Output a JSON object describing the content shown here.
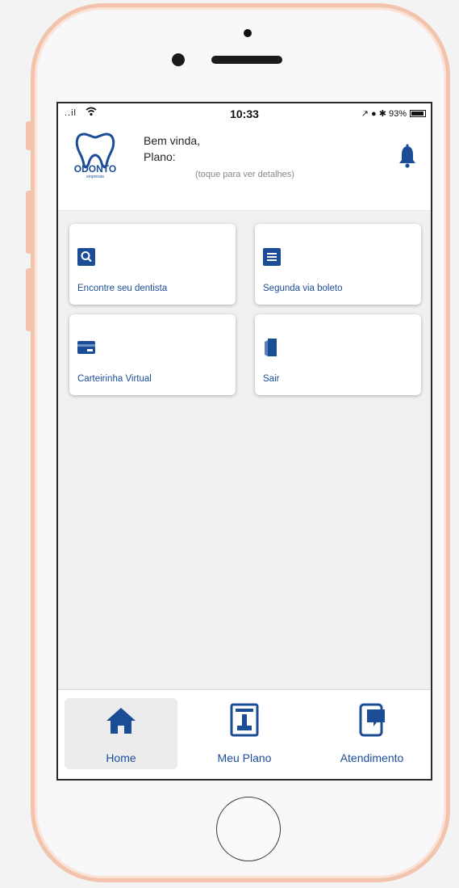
{
  "status_bar": {
    "signal": "..il",
    "time": "10:33",
    "right_indicators": "↗ ● ✱ 93%"
  },
  "header": {
    "logo_text": "ODONTO",
    "logo_sub": "empresas",
    "greeting_line1": "Bem vinda,",
    "greeting_line2": "Plano:",
    "hint": "(toque para ver detalhes)"
  },
  "menu": [
    {
      "label": "Encontre seu dentista",
      "icon": "search-icon"
    },
    {
      "label": "Segunda via boleto",
      "icon": "document-icon"
    },
    {
      "label": "Carteirinha Virtual",
      "icon": "card-icon"
    },
    {
      "label": "Sair",
      "icon": "door-exit-icon"
    }
  ],
  "tabs": [
    {
      "label": "Home",
      "icon": "home-icon",
      "active": true
    },
    {
      "label": "Meu Plano",
      "icon": "plan-icon",
      "active": false
    },
    {
      "label": "Atendimento",
      "icon": "chat-phone-icon",
      "active": false
    }
  ],
  "colors": {
    "accent": "#1b4d97",
    "phone_frame": "#f2c4ae",
    "content_bg": "#f0f0f0"
  }
}
